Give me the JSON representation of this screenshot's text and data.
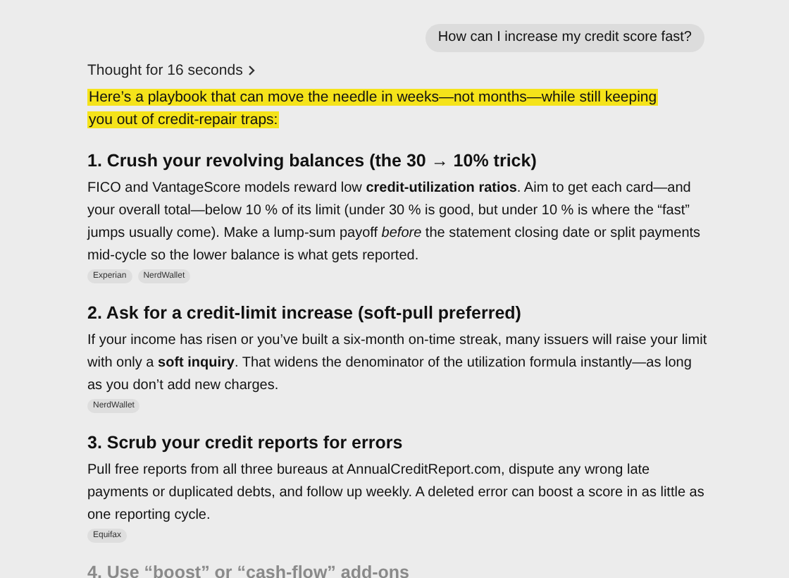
{
  "user_message": "How can I increase my credit score fast?",
  "thought": {
    "label": "Thought for 16 seconds",
    "expanded": false
  },
  "intro": "Here’s a playbook that can move the needle in weeks—not months—while still keeping you out of credit-repair traps:",
  "sections": [
    {
      "heading": "1. Crush your revolving balances (the 30 → 10% trick)",
      "body": "FICO and VantageScore models reward low **credit-utilization ratios**. Aim to get each card—and your overall total—below 10 % of its limit (under 30 % is good, but under 10 % is where the “fast” jumps usually come). Make a lump-sum payoff *before* the statement closing date or split payments mid-cycle so the lower balance is what gets reported.",
      "sources": [
        "Experian",
        "NerdWallet"
      ],
      "faded": false
    },
    {
      "heading": "2. Ask for a credit-limit increase (soft-pull preferred)",
      "body": "If your income has risen or you’ve built a six-month on-time streak, many issuers will raise your limit with only a **soft inquiry**. That widens the denominator of the utilization formula instantly—as long as you don’t add new charges.",
      "sources": [
        "NerdWallet"
      ],
      "faded": false
    },
    {
      "heading": "3. Scrub your credit reports for errors",
      "body": "Pull free reports from all three bureaus at AnnualCreditReport.com, dispute any wrong late payments or duplicated debts, and follow up weekly. A deleted error can boost a score in as little as one reporting cycle.",
      "sources": [
        "Equifax"
      ],
      "faded": false
    },
    {
      "heading": "4. Use “boost” or “cash-flow” add-ons",
      "faded": true
    }
  ]
}
